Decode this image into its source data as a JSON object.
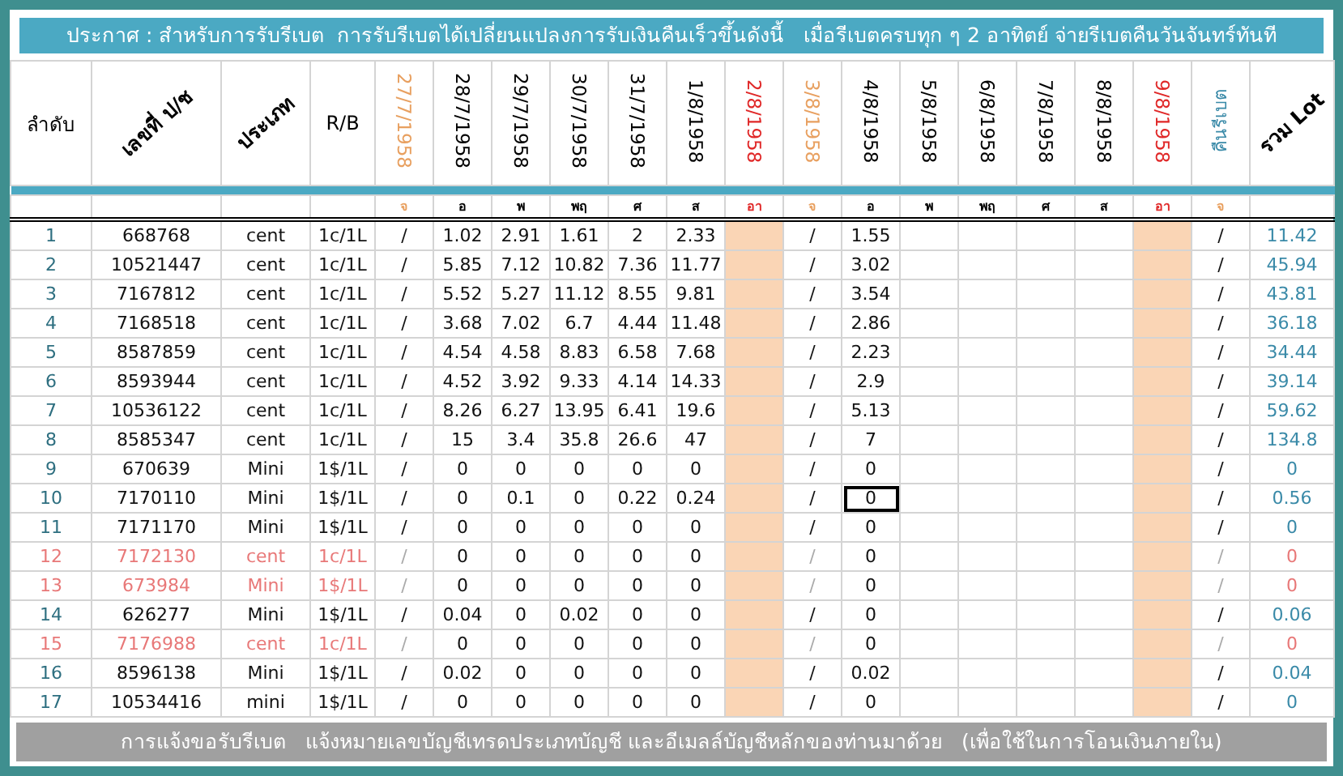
{
  "announcement": "ประกาศ : สำหรับการรับรีเบต  การรับรีเบตได้เปลี่ยนแปลงการรับเงินคืนเร็วขึ้นดังนี้   เมื่อรีเบตครบทุก ๆ 2 อาทิตย์ จ่ายรีเบตคืนวันจันทร์ทันที",
  "table": {
    "columns": [
      {
        "label": "ลำดับ",
        "kind": "plain"
      },
      {
        "label": "เลขที่ ป/ช",
        "kind": "slanted"
      },
      {
        "label": "ประเภท",
        "kind": "slanted"
      },
      {
        "label": "R/B",
        "kind": "plain"
      },
      {
        "label": "27/7/1958",
        "kind": "date",
        "color": "#e8a060",
        "shaded": false
      },
      {
        "label": "28/7/1958",
        "kind": "date",
        "color": "#000000",
        "shaded": false
      },
      {
        "label": "29/7/1958",
        "kind": "date",
        "color": "#000000",
        "shaded": false
      },
      {
        "label": "30/7/1958",
        "kind": "date",
        "color": "#000000",
        "shaded": false
      },
      {
        "label": "31/7/1958",
        "kind": "date",
        "color": "#000000",
        "shaded": false
      },
      {
        "label": "1/8/1958",
        "kind": "date",
        "color": "#000000",
        "shaded": false
      },
      {
        "label": "2/8/1958",
        "kind": "date",
        "color": "#e02828",
        "shaded": true
      },
      {
        "label": "3/8/1958",
        "kind": "date",
        "color": "#e8a060",
        "shaded": false
      },
      {
        "label": "4/8/1958",
        "kind": "date",
        "color": "#000000",
        "shaded": false
      },
      {
        "label": "5/8/1958",
        "kind": "date",
        "color": "#000000",
        "shaded": false
      },
      {
        "label": "6/8/1958",
        "kind": "date",
        "color": "#000000",
        "shaded": false
      },
      {
        "label": "7/8/1958",
        "kind": "date",
        "color": "#000000",
        "shaded": false
      },
      {
        "label": "8/8/1958",
        "kind": "date",
        "color": "#000000",
        "shaded": false
      },
      {
        "label": "9/8/1958",
        "kind": "date",
        "color": "#e02828",
        "shaded": true
      },
      {
        "label": "คืนรีเบต",
        "kind": "refund",
        "color": "#3a8aa8",
        "shaded": false
      },
      {
        "label": "รวม Lot",
        "kind": "slanted"
      }
    ],
    "weekdays": [
      {
        "label": "จ",
        "color": "#e8a060"
      },
      {
        "label": "อ",
        "color": "#000000"
      },
      {
        "label": "พ",
        "color": "#000000"
      },
      {
        "label": "พฤ",
        "color": "#000000"
      },
      {
        "label": "ศ",
        "color": "#000000"
      },
      {
        "label": "ส",
        "color": "#000000"
      },
      {
        "label": "อา",
        "color": "#e02828"
      },
      {
        "label": "จ",
        "color": "#e8a060"
      },
      {
        "label": "อ",
        "color": "#000000"
      },
      {
        "label": "พ",
        "color": "#000000"
      },
      {
        "label": "พฤ",
        "color": "#000000"
      },
      {
        "label": "ศ",
        "color": "#000000"
      },
      {
        "label": "ส",
        "color": "#000000"
      },
      {
        "label": "อา",
        "color": "#e02828"
      },
      {
        "label": "จ",
        "color": "#e8a060"
      }
    ],
    "rows": [
      {
        "no": "1",
        "account": "668768",
        "type": "cent",
        "rate": "1c/1L",
        "inactive": false,
        "selected": false,
        "start_mark": "/",
        "week1": [
          "1.02",
          "2.91",
          "1.61",
          "2",
          "2.33"
        ],
        "mid_mark": "/",
        "week2": [
          "1.55"
        ],
        "refund_mark": "/",
        "total": "11.42"
      },
      {
        "no": "2",
        "account": "10521447",
        "type": "cent",
        "rate": "1c/1L",
        "inactive": false,
        "selected": false,
        "start_mark": "/",
        "week1": [
          "5.85",
          "7.12",
          "10.82",
          "7.36",
          "11.77"
        ],
        "mid_mark": "/",
        "week2": [
          "3.02"
        ],
        "refund_mark": "/",
        "total": "45.94"
      },
      {
        "no": "3",
        "account": "7167812",
        "type": "cent",
        "rate": "1c/1L",
        "inactive": false,
        "selected": false,
        "start_mark": "/",
        "week1": [
          "5.52",
          "5.27",
          "11.12",
          "8.55",
          "9.81"
        ],
        "mid_mark": "/",
        "week2": [
          "3.54"
        ],
        "refund_mark": "/",
        "total": "43.81"
      },
      {
        "no": "4",
        "account": "7168518",
        "type": "cent",
        "rate": "1c/1L",
        "inactive": false,
        "selected": false,
        "start_mark": "/",
        "week1": [
          "3.68",
          "7.02",
          "6.7",
          "4.44",
          "11.48"
        ],
        "mid_mark": "/",
        "week2": [
          "2.86"
        ],
        "refund_mark": "/",
        "total": "36.18"
      },
      {
        "no": "5",
        "account": "8587859",
        "type": "cent",
        "rate": "1c/1L",
        "inactive": false,
        "selected": false,
        "start_mark": "/",
        "week1": [
          "4.54",
          "4.58",
          "8.83",
          "6.58",
          "7.68"
        ],
        "mid_mark": "/",
        "week2": [
          "2.23"
        ],
        "refund_mark": "/",
        "total": "34.44"
      },
      {
        "no": "6",
        "account": "8593944",
        "type": "cent",
        "rate": "1c/1L",
        "inactive": false,
        "selected": false,
        "start_mark": "/",
        "week1": [
          "4.52",
          "3.92",
          "9.33",
          "4.14",
          "14.33"
        ],
        "mid_mark": "/",
        "week2": [
          "2.9"
        ],
        "refund_mark": "/",
        "total": "39.14"
      },
      {
        "no": "7",
        "account": "10536122",
        "type": "cent",
        "rate": "1c/1L",
        "inactive": false,
        "selected": false,
        "start_mark": "/",
        "week1": [
          "8.26",
          "6.27",
          "13.95",
          "6.41",
          "19.6"
        ],
        "mid_mark": "/",
        "week2": [
          "5.13"
        ],
        "refund_mark": "/",
        "total": "59.62"
      },
      {
        "no": "8",
        "account": "8585347",
        "type": "cent",
        "rate": "1c/1L",
        "inactive": false,
        "selected": false,
        "start_mark": "/",
        "week1": [
          "15",
          "3.4",
          "35.8",
          "26.6",
          "47"
        ],
        "mid_mark": "/",
        "week2": [
          "7"
        ],
        "refund_mark": "/",
        "total": "134.8"
      },
      {
        "no": "9",
        "account": "670639",
        "type": "Mini",
        "rate": "1$/1L",
        "inactive": false,
        "selected": false,
        "start_mark": "/",
        "week1": [
          "0",
          "0",
          "0",
          "0",
          "0"
        ],
        "mid_mark": "/",
        "week2": [
          "0"
        ],
        "refund_mark": "/",
        "total": "0"
      },
      {
        "no": "10",
        "account": "7170110",
        "type": "Mini",
        "rate": "1$/1L",
        "inactive": false,
        "selected": true,
        "start_mark": "/",
        "week1": [
          "0",
          "0.1",
          "0",
          "0.22",
          "0.24"
        ],
        "mid_mark": "/",
        "week2": [
          "0"
        ],
        "refund_mark": "/",
        "total": "0.56"
      },
      {
        "no": "11",
        "account": "7171170",
        "type": "Mini",
        "rate": "1$/1L",
        "inactive": false,
        "selected": false,
        "start_mark": "/",
        "week1": [
          "0",
          "0",
          "0",
          "0",
          "0"
        ],
        "mid_mark": "/",
        "week2": [
          "0"
        ],
        "refund_mark": "/",
        "total": "0"
      },
      {
        "no": "12",
        "account": "7172130",
        "type": "cent",
        "rate": "1c/1L",
        "inactive": true,
        "selected": false,
        "start_mark": "/",
        "week1": [
          "0",
          "0",
          "0",
          "0",
          "0"
        ],
        "mid_mark": "/",
        "week2": [
          "0"
        ],
        "refund_mark": "/",
        "total": "0"
      },
      {
        "no": "13",
        "account": "673984",
        "type": "Mini",
        "rate": "1$/1L",
        "inactive": true,
        "selected": false,
        "start_mark": "/",
        "week1": [
          "0",
          "0",
          "0",
          "0",
          "0"
        ],
        "mid_mark": "/",
        "week2": [
          "0"
        ],
        "refund_mark": "/",
        "total": "0"
      },
      {
        "no": "14",
        "account": "626277",
        "type": "Mini",
        "rate": "1$/1L",
        "inactive": false,
        "selected": false,
        "start_mark": "/",
        "week1": [
          "0.04",
          "0",
          "0.02",
          "0",
          "0"
        ],
        "mid_mark": "/",
        "week2": [
          "0"
        ],
        "refund_mark": "/",
        "total": "0.06"
      },
      {
        "no": "15",
        "account": "7176988",
        "type": "cent",
        "rate": "1c/1L",
        "inactive": true,
        "selected": false,
        "start_mark": "/",
        "week1": [
          "0",
          "0",
          "0",
          "0",
          "0"
        ],
        "mid_mark": "/",
        "week2": [
          "0"
        ],
        "refund_mark": "/",
        "total": "0"
      },
      {
        "no": "16",
        "account": "8596138",
        "type": "Mini",
        "rate": "1$/1L",
        "inactive": false,
        "selected": false,
        "start_mark": "/",
        "week1": [
          "0.02",
          "0",
          "0",
          "0",
          "0"
        ],
        "mid_mark": "/",
        "week2": [
          "0.02"
        ],
        "refund_mark": "/",
        "total": "0.04"
      },
      {
        "no": "17",
        "account": "10534416",
        "type": "mini",
        "rate": "1$/1L",
        "inactive": false,
        "selected": false,
        "start_mark": "/",
        "week1": [
          "0",
          "0",
          "0",
          "0",
          "0"
        ],
        "mid_mark": "/",
        "week2": [
          "0"
        ],
        "refund_mark": "/",
        "total": "0"
      }
    ]
  },
  "footer": "การแจ้งขอรับรีเบต   แจ้งหมายเลขบัญชีเทรดประเภทบัญชี และอีเมลล์บัญชีหลักของท่านมาด้วย   (เพื่อใช้ในการโอนเงินภายใน)"
}
